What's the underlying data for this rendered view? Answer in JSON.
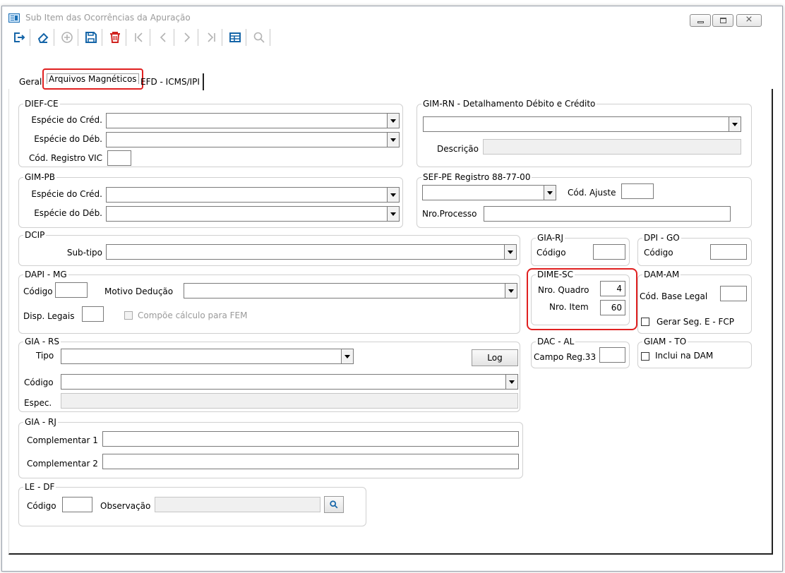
{
  "window": {
    "title": "Sub Item das Ocorrências da Apuração",
    "close_glyph": "⨯"
  },
  "toolbar": {
    "icons": [
      "exit-icon",
      "eraser-icon",
      "add-icon",
      "save-icon",
      "delete-icon",
      "first-icon",
      "prev-icon",
      "next-icon",
      "last-icon",
      "grid-icon",
      "search-icon"
    ]
  },
  "tabs": {
    "geral": "Geral",
    "arquivos": "Arquivos Magnéticos",
    "efd": "EFD - ICMS/IPI"
  },
  "dief_ce": {
    "legend": "DIEF-CE",
    "especie_cred": "Espécie do Créd.",
    "especie_deb": "Espécie do Déb.",
    "cod_registro": "Cód. Registro VIC"
  },
  "gim_rn": {
    "legend": "GIM-RN - Detalhamento Débito e Crédito",
    "descricao": "Descrição"
  },
  "gim_pb": {
    "legend": "GIM-PB",
    "especie_cred": "Espécie do Créd.",
    "especie_deb": "Espécie do Déb."
  },
  "sef_pe": {
    "legend": "SEF-PE Registro 88-77-00",
    "cod_ajuste": "Cód. Ajuste",
    "nro_processo": "Nro.Processo"
  },
  "dcip": {
    "legend": "DCIP",
    "subtipo": "Sub-tipo"
  },
  "gia_rj_top": {
    "legend": "GIA-RJ",
    "codigo": "Código"
  },
  "dpi_go": {
    "legend": "DPI - GO",
    "codigo": "Código"
  },
  "dapi_mg": {
    "legend": "DAPI - MG",
    "codigo": "Código",
    "motivo": "Motivo Dedução",
    "disp_legais": "Disp. Legais",
    "compoe": "Compõe cálculo para FEM"
  },
  "dime_sc": {
    "legend": "DIME-SC",
    "nro_quadro": "Nro. Quadro",
    "nro_quadro_value": "4",
    "nro_item": "Nro. Item",
    "nro_item_value": "60"
  },
  "dam_am": {
    "legend": "DAM-AM",
    "cod_base": "Cód. Base Legal",
    "gerar_seg": "Gerar Seg. E - FCP"
  },
  "gia_rs": {
    "legend": "GIA - RS",
    "tipo": "Tipo",
    "log": "Log",
    "codigo": "Código",
    "espec": "Espec."
  },
  "dac_al": {
    "legend": "DAC - AL",
    "campo_reg": "Campo Reg.33"
  },
  "giam_to": {
    "legend": "GIAM - TO",
    "inclui": "Inclui na DAM"
  },
  "gia_rj": {
    "legend": "GIA - RJ",
    "comp1": "Complementar 1",
    "comp2": "Complementar 2"
  },
  "le_df": {
    "legend": "LE - DF",
    "codigo": "Código",
    "observacao": "Observação"
  },
  "colors": {
    "accent_red": "#e02020",
    "delete_red": "#d0231f",
    "toolbar_blue": "#1565a8"
  }
}
